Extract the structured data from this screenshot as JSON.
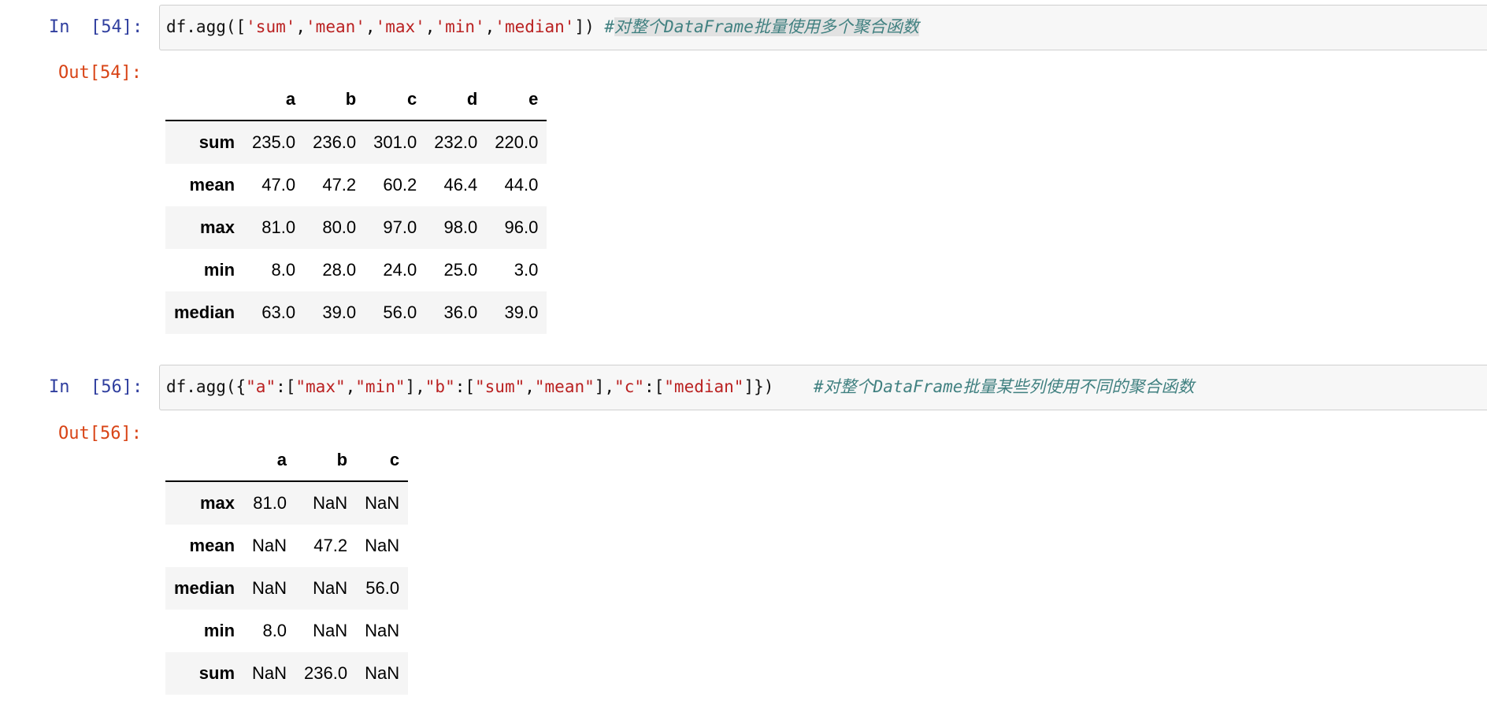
{
  "cells": [
    {
      "in_prompt": "In  [54]:",
      "out_prompt": "Out[54]:",
      "code": {
        "p1": "df.agg([",
        "s1": "'sum'",
        "c1": ",",
        "s2": "'mean'",
        "c2": ",",
        "s3": "'max'",
        "c3": ",",
        "s4": "'min'",
        "c4": ",",
        "s5": "'median'",
        "p2": "]) ",
        "comment_hash": "#",
        "comment_text": "对整个DataFrame批量使用多个聚合函数"
      },
      "table": {
        "columns": [
          "a",
          "b",
          "c",
          "d",
          "e"
        ],
        "rows": [
          {
            "index": "sum",
            "values": [
              "235.0",
              "236.0",
              "301.0",
              "232.0",
              "220.0"
            ]
          },
          {
            "index": "mean",
            "values": [
              "47.0",
              "47.2",
              "60.2",
              "46.4",
              "44.0"
            ]
          },
          {
            "index": "max",
            "values": [
              "81.0",
              "80.0",
              "97.0",
              "98.0",
              "96.0"
            ]
          },
          {
            "index": "min",
            "values": [
              "8.0",
              "28.0",
              "24.0",
              "25.0",
              "3.0"
            ]
          },
          {
            "index": "median",
            "values": [
              "63.0",
              "39.0",
              "56.0",
              "36.0",
              "39.0"
            ]
          }
        ]
      }
    },
    {
      "in_prompt": "In  [56]:",
      "out_prompt": "Out[56]:",
      "code": {
        "p1": "df.agg({",
        "k1": "\"a\"",
        "p2": ":[",
        "s1": "\"max\"",
        "c1": ",",
        "s2": "\"min\"",
        "p3": "],",
        "k2": "\"b\"",
        "p4": ":[",
        "s3": "\"sum\"",
        "c2": ",",
        "s4": "\"mean\"",
        "p5": "],",
        "k3": "\"c\"",
        "p6": ":[",
        "s5": "\"median\"",
        "p7": "]})    ",
        "comment": "#对整个DataFrame批量某些列使用不同的聚合函数"
      },
      "table": {
        "columns": [
          "a",
          "b",
          "c"
        ],
        "rows": [
          {
            "index": "max",
            "values": [
              "81.0",
              "NaN",
              "NaN"
            ]
          },
          {
            "index": "mean",
            "values": [
              "NaN",
              "47.2",
              "NaN"
            ]
          },
          {
            "index": "median",
            "values": [
              "NaN",
              "NaN",
              "56.0"
            ]
          },
          {
            "index": "min",
            "values": [
              "8.0",
              "NaN",
              "NaN"
            ]
          },
          {
            "index": "sum",
            "values": [
              "NaN",
              "236.0",
              "NaN"
            ]
          }
        ]
      }
    }
  ]
}
